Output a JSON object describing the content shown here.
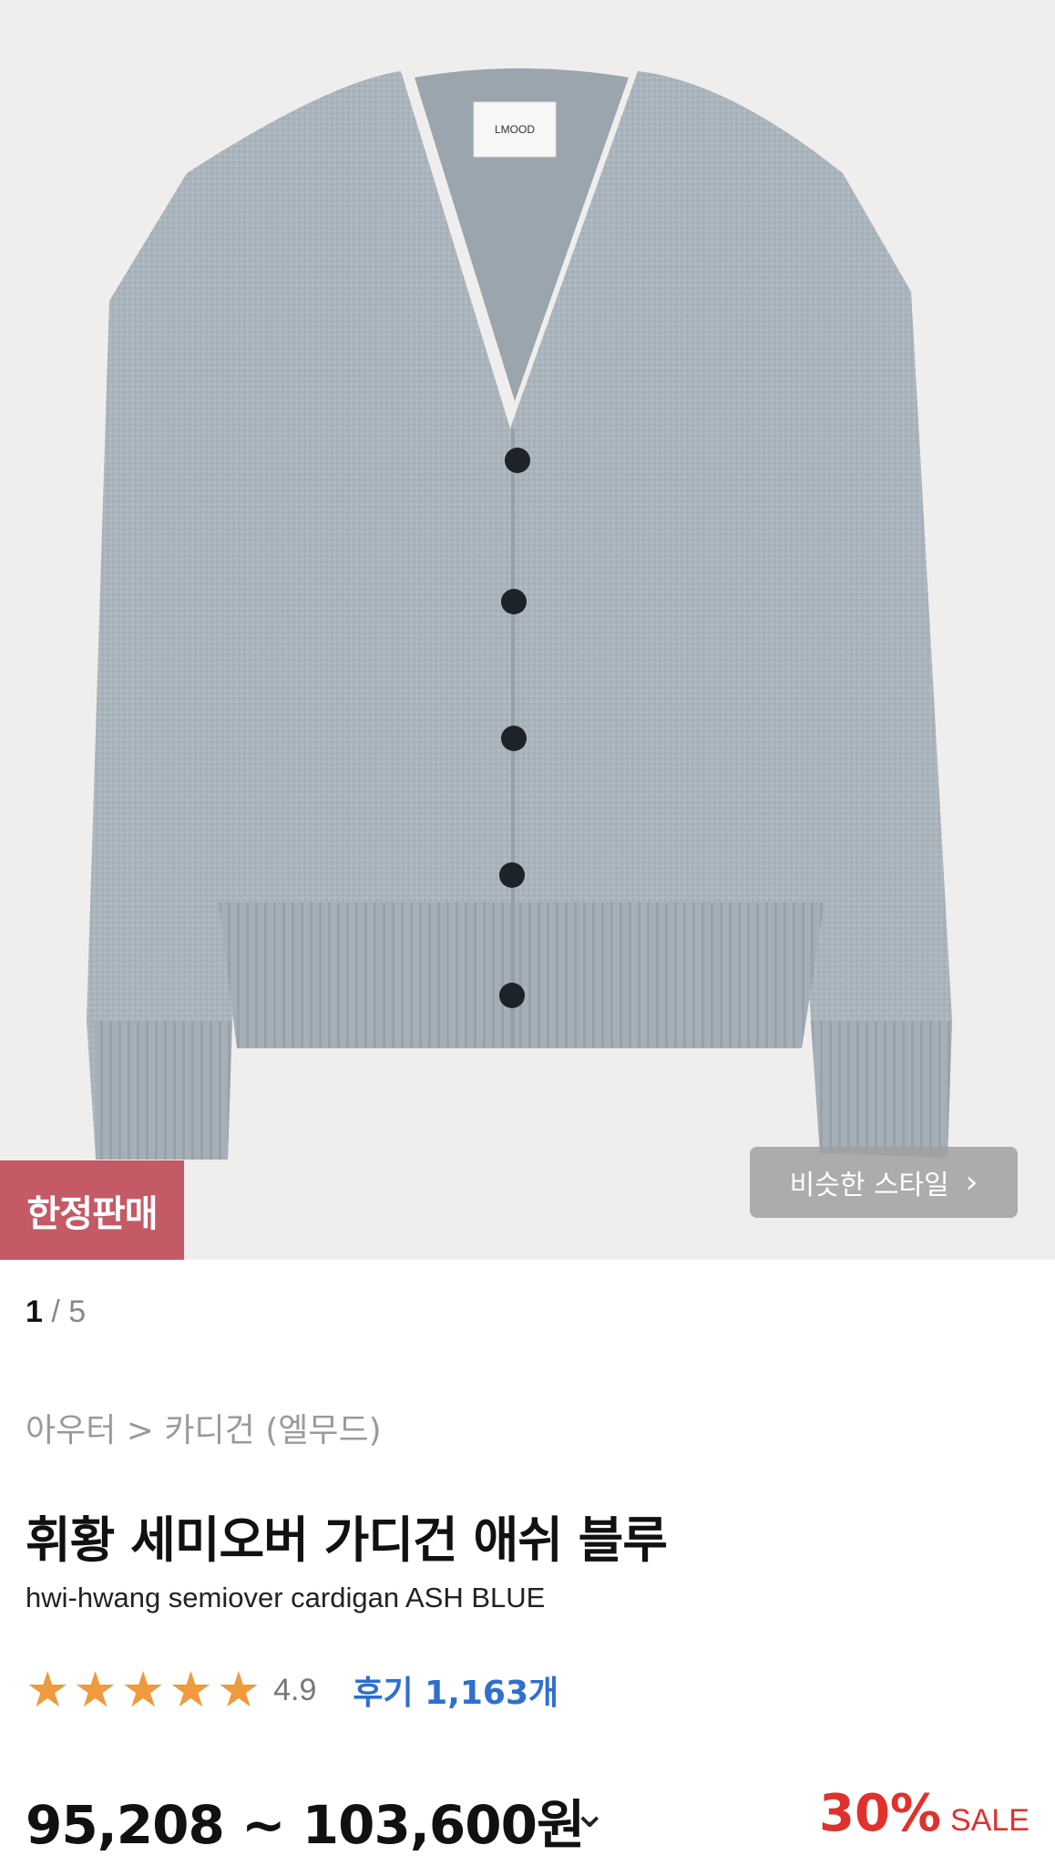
{
  "product_image": {
    "brand_tag": "LMOOD",
    "limited_badge": "한정판매",
    "similar_style_button": "비슷한 스타일",
    "colors": {
      "background": "#efeeec",
      "knit": "#a9b4bd",
      "badge": "#c45a66"
    }
  },
  "pager": {
    "current": "1",
    "separator": " / ",
    "total": "5"
  },
  "breadcrumb": "아우터 > 카디건 (엘무드)",
  "title_ko": "휘황 세미오버 가디건 애쉬 블루",
  "title_en": "hwi-hwang semiover cardigan ASH BLUE",
  "rating": {
    "stars": 5,
    "score": "4.9",
    "reviews_label": "후기 1,163개"
  },
  "price": {
    "range": "95,208 ~ 103,600원",
    "discount": "30%",
    "sale_label": "SALE"
  }
}
